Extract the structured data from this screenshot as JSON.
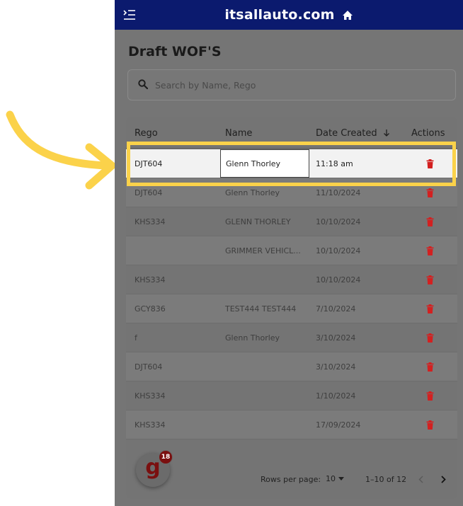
{
  "header": {
    "brand": "itsallauto.com",
    "menu_icon": "menu-collapse-icon",
    "home_icon": "home-icon"
  },
  "page": {
    "title": "Draft WOF'S"
  },
  "search": {
    "placeholder": "Search by Name, Rego",
    "value": ""
  },
  "table": {
    "columns": {
      "rego": "Rego",
      "name": "Name",
      "date": "Date Created",
      "sort_icon": "arrow-down-icon",
      "actions": "Actions"
    },
    "rows": [
      {
        "rego": "DJT604",
        "name": "Glenn Thorley",
        "date": "11:18 am"
      },
      {
        "rego": "DJT604",
        "name": "Glenn Thorley",
        "date": "11/10/2024"
      },
      {
        "rego": "KHS334",
        "name": "GLENN THORLEY",
        "date": "10/10/2024"
      },
      {
        "rego": "",
        "name": "GRIMMER VEHICL...",
        "date": "10/10/2024"
      },
      {
        "rego": "KHS334",
        "name": "",
        "date": "10/10/2024"
      },
      {
        "rego": "GCY836",
        "name": "TEST444 TEST444",
        "date": "7/10/2024"
      },
      {
        "rego": "f",
        "name": "Glenn Thorley",
        "date": "3/10/2024"
      },
      {
        "rego": "DJT604",
        "name": "",
        "date": "3/10/2024"
      },
      {
        "rego": "KHS334",
        "name": "",
        "date": "1/10/2024"
      },
      {
        "rego": "KHS334",
        "name": "",
        "date": "17/09/2024"
      }
    ],
    "selected_row": 0,
    "delete_icon": "trash-icon"
  },
  "pagination": {
    "rows_per_page_label": "Rows per page:",
    "rows_per_page": "10",
    "range": "1–10 of 12"
  },
  "fab": {
    "letter": "g",
    "badge": "18"
  },
  "colors": {
    "header_bg": "#0b1a6e",
    "overlay": "#757575",
    "delete": "#d32020",
    "highlight": "#fbd24a",
    "badge": "#7a1010"
  }
}
